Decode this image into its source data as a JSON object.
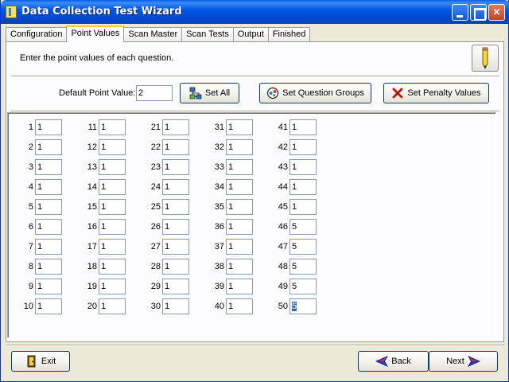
{
  "window": {
    "title": "Data Collection Test Wizard",
    "colors": {
      "titlebar": "#0058E6",
      "face": "#ECE9D8",
      "active_tab_accent": "#FFC83C"
    },
    "controls": {
      "minimize": "minimize-icon",
      "maximize": "maximize-icon",
      "close": "×"
    }
  },
  "tabs": [
    "Configuration",
    "Point Values",
    "Scan Master",
    "Scan Tests",
    "Output",
    "Finished"
  ],
  "active_tab": "Point Values",
  "instructions": "Enter the point values of each question.",
  "default_point": {
    "label": "Default Point Value:",
    "value": "2"
  },
  "buttons": {
    "set_all": "Set All",
    "set_question_groups": "Set Question Groups",
    "set_penalty_values": "Set Penalty Values",
    "exit": "Exit",
    "back": "Back",
    "next": "Next"
  },
  "questions": [
    {
      "n": "1",
      "v": "1"
    },
    {
      "n": "2",
      "v": "1"
    },
    {
      "n": "3",
      "v": "1"
    },
    {
      "n": "4",
      "v": "1"
    },
    {
      "n": "5",
      "v": "1"
    },
    {
      "n": "6",
      "v": "1"
    },
    {
      "n": "7",
      "v": "1"
    },
    {
      "n": "8",
      "v": "1"
    },
    {
      "n": "9",
      "v": "1"
    },
    {
      "n": "10",
      "v": "1"
    },
    {
      "n": "11",
      "v": "1"
    },
    {
      "n": "12",
      "v": "1"
    },
    {
      "n": "13",
      "v": "1"
    },
    {
      "n": "14",
      "v": "1"
    },
    {
      "n": "15",
      "v": "1"
    },
    {
      "n": "16",
      "v": "1"
    },
    {
      "n": "17",
      "v": "1"
    },
    {
      "n": "18",
      "v": "1"
    },
    {
      "n": "19",
      "v": "1"
    },
    {
      "n": "20",
      "v": "1"
    },
    {
      "n": "21",
      "v": "1"
    },
    {
      "n": "22",
      "v": "1"
    },
    {
      "n": "23",
      "v": "1"
    },
    {
      "n": "24",
      "v": "1"
    },
    {
      "n": "25",
      "v": "1"
    },
    {
      "n": "26",
      "v": "1"
    },
    {
      "n": "27",
      "v": "1"
    },
    {
      "n": "28",
      "v": "1"
    },
    {
      "n": "29",
      "v": "1"
    },
    {
      "n": "30",
      "v": "1"
    },
    {
      "n": "31",
      "v": "1"
    },
    {
      "n": "32",
      "v": "1"
    },
    {
      "n": "33",
      "v": "1"
    },
    {
      "n": "34",
      "v": "1"
    },
    {
      "n": "35",
      "v": "1"
    },
    {
      "n": "36",
      "v": "1"
    },
    {
      "n": "37",
      "v": "1"
    },
    {
      "n": "38",
      "v": "1"
    },
    {
      "n": "39",
      "v": "1"
    },
    {
      "n": "40",
      "v": "1"
    },
    {
      "n": "41",
      "v": "1"
    },
    {
      "n": "42",
      "v": "1"
    },
    {
      "n": "43",
      "v": "1"
    },
    {
      "n": "44",
      "v": "1"
    },
    {
      "n": "45",
      "v": "1"
    },
    {
      "n": "46",
      "v": "5"
    },
    {
      "n": "47",
      "v": "5"
    },
    {
      "n": "48",
      "v": "5"
    },
    {
      "n": "49",
      "v": "5"
    },
    {
      "n": "50",
      "v": "5"
    }
  ]
}
